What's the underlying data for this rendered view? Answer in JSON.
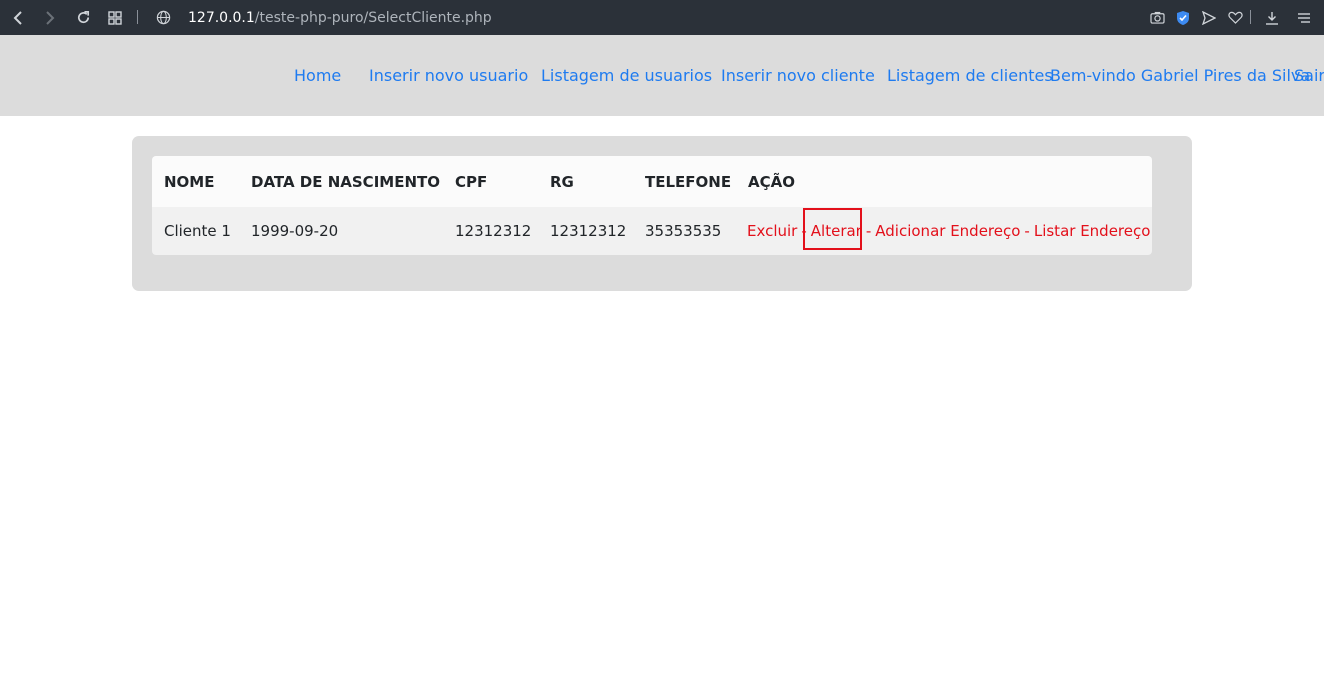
{
  "browser": {
    "url_host": "127.0.0.1",
    "url_path": "/teste-php-puro/SelectCliente.php"
  },
  "navbar": {
    "links": [
      {
        "label": "Home"
      },
      {
        "label": "Inserir novo usuario"
      },
      {
        "label": "Listagem de usuarios"
      },
      {
        "label": "Inserir novo cliente"
      },
      {
        "label": "Listagem de clientes"
      },
      {
        "label": "Bem-vindo Gabriel Pires da Silva"
      },
      {
        "label": "Sair"
      }
    ]
  },
  "table": {
    "headers": [
      "NOME",
      "DATA DE NASCIMENTO",
      "CPF",
      "RG",
      "TELEFONE",
      "AÇÃO"
    ],
    "rows": [
      {
        "nome": "Cliente 1",
        "nascimento": "1999-09-20",
        "cpf": "12312312",
        "rg": "12312312",
        "telefone": "35353535",
        "actions": {
          "excluir": "Excluir",
          "alterar": "Alterar",
          "adicionar_endereco": "Adicionar Endereço",
          "listar_endereco": "Listar Endereço",
          "separator": "-"
        }
      }
    ]
  },
  "colors": {
    "link_blue": "#1e7bf0",
    "action_red": "#e3101b",
    "navbar_bg": "#dcdcdc",
    "browser_bar": "#2b3139"
  }
}
